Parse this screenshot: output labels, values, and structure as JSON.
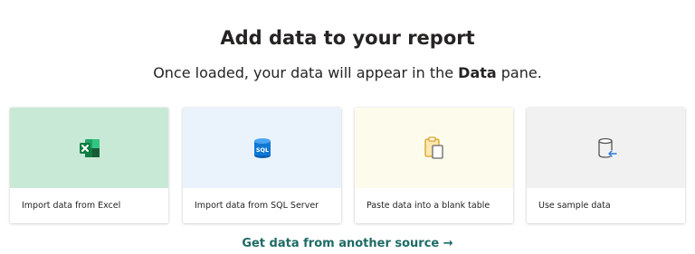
{
  "header": {
    "title": "Add data to your report",
    "subtitle_prefix": "Once loaded, your data will appear in the ",
    "subtitle_bold": "Data",
    "subtitle_suffix": " pane."
  },
  "cards": [
    {
      "label": "Import data from Excel",
      "icon": "excel-icon",
      "color": "#c8e9d6"
    },
    {
      "label": "Import data from SQL Server",
      "icon": "sql-database-icon",
      "color": "#eaf3fc",
      "icon_text": "SQL"
    },
    {
      "label": "Paste data into a blank table",
      "icon": "clipboard-paste-icon",
      "color": "#fdfcec"
    },
    {
      "label": "Use sample data",
      "icon": "database-arrow-icon",
      "color": "#f1f1f1"
    }
  ],
  "link": {
    "label": "Get data from another source →",
    "color": "#1e6b66"
  }
}
